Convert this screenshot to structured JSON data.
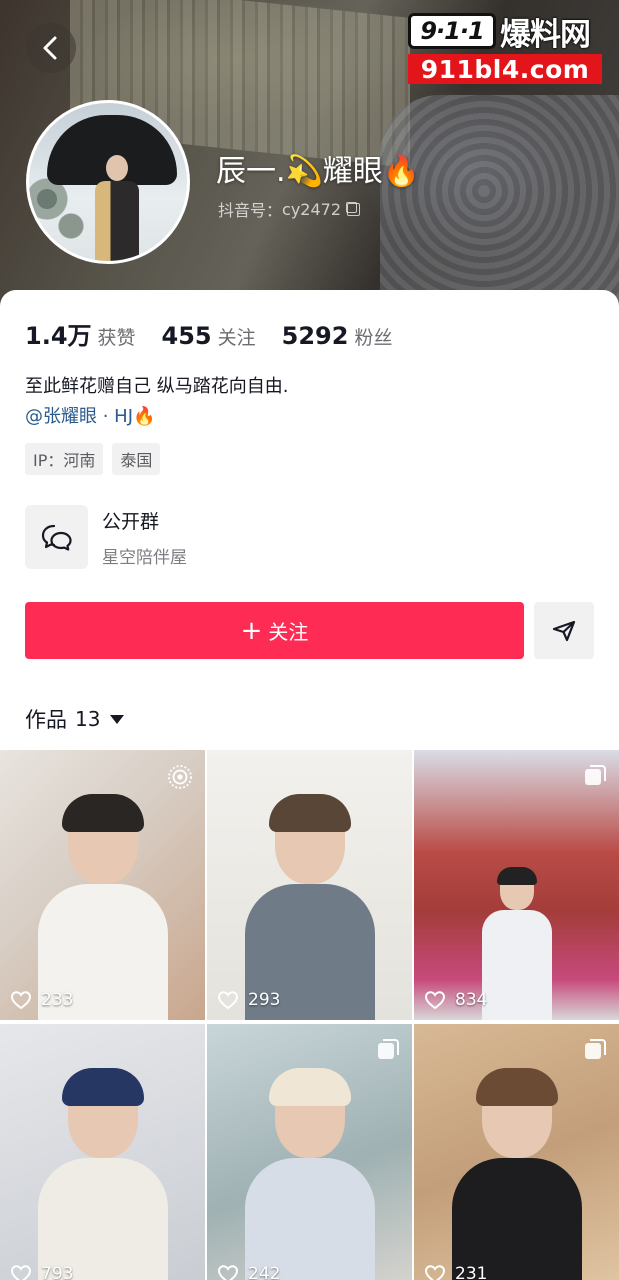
{
  "watermark": {
    "badge": "9·1·1",
    "title": "爆料网",
    "url": "911bl4.com"
  },
  "profile": {
    "nickname": "辰一.💫耀眼🔥",
    "account_label": "抖音号：",
    "account_id": "cy2472"
  },
  "stats": [
    {
      "value": "1.4万",
      "label": "获赞"
    },
    {
      "value": "455",
      "label": "关注"
    },
    {
      "value": "5292",
      "label": "粉丝"
    }
  ],
  "bio": {
    "line1": "至此鲜花赠自己 纵马踏花向自由.",
    "mention": "@张耀眼 · HJ🔥"
  },
  "tags": [
    "IP：河南",
    "泰国"
  ],
  "group": {
    "title": "公开群",
    "subtitle": "星空陪伴屋"
  },
  "actions": {
    "follow_label": "关注"
  },
  "works": {
    "label": "作品",
    "count": "13",
    "items": [
      {
        "likes": "233",
        "badge": "live-photo-icon"
      },
      {
        "likes": "293",
        "badge": ""
      },
      {
        "likes": "834",
        "badge": "multi-image-icon"
      },
      {
        "likes": "793",
        "badge": ""
      },
      {
        "likes": "242",
        "badge": "multi-image-icon"
      },
      {
        "likes": "231",
        "badge": "multi-image-icon"
      }
    ]
  },
  "colors": {
    "accent": "#fe2c55",
    "mention": "#2b5a8c",
    "watermark_red": "#e3151b"
  }
}
